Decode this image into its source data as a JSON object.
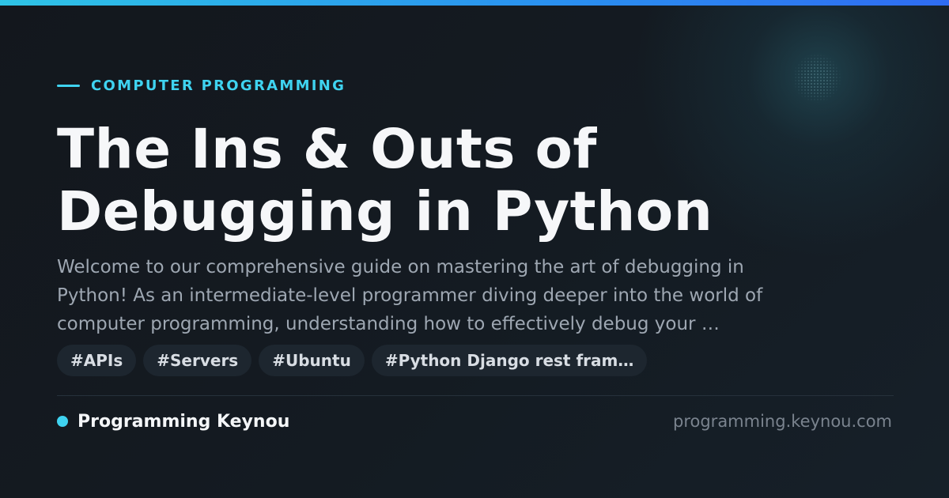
{
  "category": "COMPUTER PROGRAMMING",
  "title_lines": [
    "The Ins & Outs of",
    "Debugging in Python"
  ],
  "description_lines": [
    "Welcome to our comprehensive guide on mastering the art of debugging in",
    "Python! As an intermediate-level programmer diving deeper into the world of",
    "computer programming, understanding how to effectively debug your …"
  ],
  "tags": [
    "#APIs",
    "#Servers",
    "#Ubuntu",
    "#Python Django rest fram…"
  ],
  "brand_name": "Programming Keynou",
  "domain": "programming.keynou.com",
  "colors": {
    "accent": "#3fd3f0",
    "background": "#13171d",
    "top_bar_start": "#2ec4e6",
    "top_bar_end": "#2f6cf2",
    "title": "#f6f7f9",
    "description": "#9ea7b2",
    "tag_background": "#1d262f",
    "domain": "#7a838e"
  },
  "icons": {
    "kicker": "accent-line",
    "brand": "dot-icon"
  }
}
